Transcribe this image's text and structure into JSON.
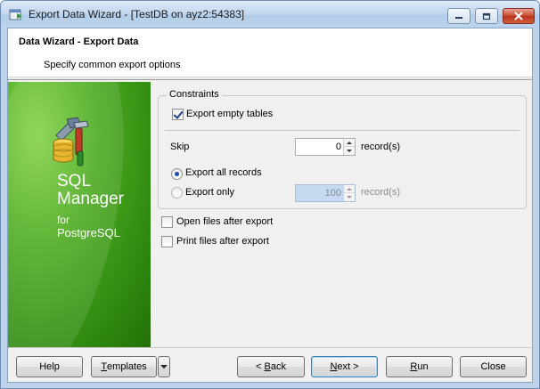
{
  "window": {
    "title": "Export Data Wizard - [TestDB on ayz2:54383]"
  },
  "header": {
    "title": "Data Wizard - Export Data",
    "subtitle": "Specify common export options"
  },
  "banner": {
    "product_line1": "SQL",
    "product_line2": "Manager",
    "product_for": "for",
    "product_db": "PostgreSQL"
  },
  "constraints": {
    "caption": "Constraints",
    "export_empty_tables": {
      "label": "Export empty tables",
      "checked": true
    },
    "skip": {
      "label": "Skip",
      "value": "0",
      "unit": "record(s)"
    },
    "export_all_records": {
      "label": "Export all records",
      "selected": true
    },
    "export_only": {
      "label": "Export only",
      "selected": false,
      "value": "100",
      "unit": "record(s)"
    }
  },
  "options": {
    "open_files": {
      "label": "Open files after export",
      "checked": false
    },
    "print_files": {
      "label": "Print files after export",
      "checked": false
    }
  },
  "buttons": {
    "help": "Help",
    "templates_first": "T",
    "templates_rest": "emplates",
    "back_prefix": "< ",
    "back_u": "B",
    "back_rest": "ack",
    "next_u": "N",
    "next_rest": "ext >",
    "run_u": "R",
    "run_rest": "un",
    "close": "Close"
  },
  "colors": {
    "banner_green": "#3f9c18",
    "selection_blue": "#1c4fa8",
    "disabled_field": "#c5d9f0"
  }
}
